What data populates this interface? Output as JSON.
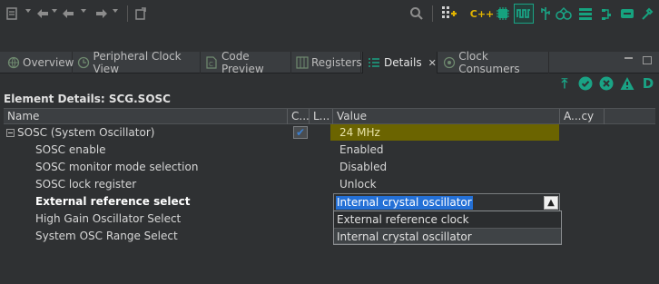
{
  "toolbar": {
    "left_icons": [
      "script-icon",
      "back-arrow-icon",
      "forward-arrow-icon",
      "export-icon"
    ],
    "right_icons": [
      "search-icon",
      "grid-add-icon",
      "c-plus-plus-icon",
      "chip-icon",
      "pins-icon",
      "clock-signal-icon",
      "usb-icon",
      "peripherals-icon",
      "stack-icon",
      "power-icon",
      "deploy-icon",
      "tools-icon"
    ]
  },
  "tabs": [
    {
      "label": "Overview",
      "icon": "globe-icon",
      "active": false
    },
    {
      "label": "Peripheral Clock View",
      "icon": "clock-icon",
      "active": false
    },
    {
      "label": "Code Preview",
      "icon": "code-file-icon",
      "active": false
    },
    {
      "label": "Registers",
      "icon": "registers-icon",
      "active": false
    },
    {
      "label": "Details",
      "icon": "list-icon",
      "active": true
    },
    {
      "label": "Clock Consumers",
      "icon": "consumers-icon",
      "active": false
    }
  ],
  "view_toolbar_icons": [
    "export-top-icon",
    "check-circle-icon",
    "error-icon",
    "warning-icon",
    "d-icon"
  ],
  "view_toolbar_glyphs": [
    "⤒",
    "✔",
    "✖",
    "▲",
    "D"
  ],
  "element_title": "Element Details: SCG.SOSC",
  "table": {
    "columns": [
      "Name",
      "C...",
      "L...",
      "Value",
      "A...cy"
    ],
    "rows": [
      {
        "name": "SOSC (System Oscillator)",
        "value": "24 MHz",
        "expandable": true,
        "checked": true,
        "bold": false
      },
      {
        "name": "SOSC enable",
        "value": "Enabled",
        "bold": false
      },
      {
        "name": "SOSC monitor mode selection",
        "value": "Disabled",
        "bold": false
      },
      {
        "name": "SOSC lock register",
        "value": "Unlock",
        "bold": false
      },
      {
        "name": "External reference select",
        "value": "Internal crystal oscillator",
        "bold": true,
        "editing": true
      },
      {
        "name": "High Gain Oscillator Select",
        "value": "",
        "bold": false
      },
      {
        "name": "System OSC Range Select",
        "value": "",
        "bold": false
      }
    ]
  },
  "combo": {
    "value": "Internal crystal oscillator",
    "options": [
      "External reference clock",
      "Internal crystal oscillator"
    ],
    "selected": "Internal crystal oscillator"
  },
  "colors": {
    "accent": "#1aa385",
    "freq_highlight": "#6b6400",
    "selection": "#2470d6",
    "background": "#2f3133"
  }
}
